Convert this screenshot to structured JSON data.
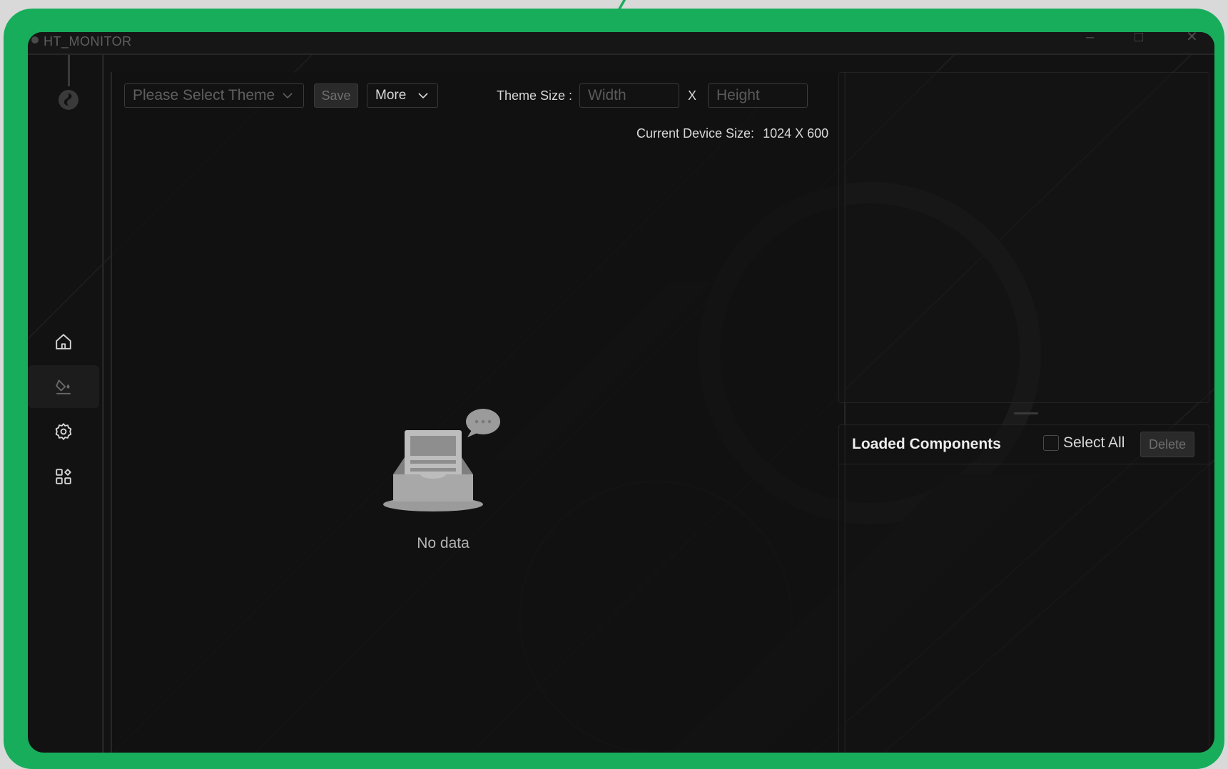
{
  "window": {
    "title": "HT_MONITOR",
    "minimize_glyph": "–",
    "maximize_glyph": "□",
    "close_glyph": "✕"
  },
  "sidebar": {
    "items": [
      {
        "name": "home",
        "icon": "home-icon",
        "active": false
      },
      {
        "name": "theme",
        "icon": "paint-bucket-icon",
        "active": true
      },
      {
        "name": "settings",
        "icon": "gear-icon",
        "active": false
      },
      {
        "name": "components",
        "icon": "grid-plus-icon",
        "active": false
      }
    ]
  },
  "toolbar": {
    "theme_select_placeholder": "Please Select Theme",
    "save_label": "Save",
    "more_label": "More",
    "theme_size_label": "Theme Size :",
    "width_placeholder": "Width",
    "height_placeholder": "Height",
    "size_separator": "X",
    "device_size_label": "Current Device Size:",
    "device_size_value": "1024 X 600"
  },
  "empty_state": {
    "text": "No data",
    "icon": "empty-inbox-icon"
  },
  "components": {
    "title": "Loaded Components",
    "select_all_label": "Select All",
    "select_all_checked": false,
    "delete_label": "Delete"
  },
  "colors": {
    "frame": "#18ad5b",
    "background": "#121212",
    "text_primary": "#d8d8d8",
    "text_muted": "#5f5f5f"
  }
}
